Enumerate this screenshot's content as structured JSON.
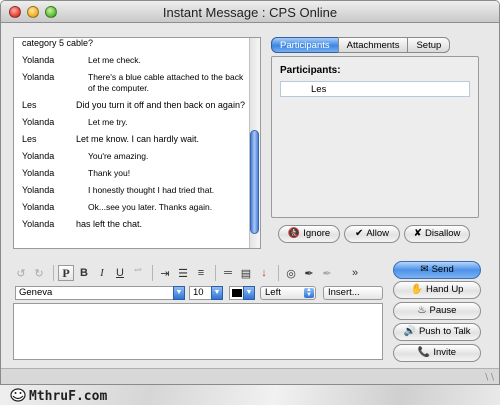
{
  "window": {
    "title": "Instant Message : CPS Online"
  },
  "transcript": {
    "messages": [
      {
        "sender": "",
        "text": "category 5 cable?"
      },
      {
        "sender": "Yolanda",
        "text": "Let me check."
      },
      {
        "sender": "Yolanda",
        "text": "There's a blue cable attached to the back of the computer."
      },
      {
        "sender": "Les",
        "text": "Did you turn it off and then back on again?"
      },
      {
        "sender": "Yolanda",
        "text": "Let me try."
      },
      {
        "sender": "Les",
        "text": "Let me know.  I can hardly wait."
      },
      {
        "sender": "Yolanda",
        "text": "You're amazing."
      },
      {
        "sender": "Yolanda",
        "text": "Thank you!"
      },
      {
        "sender": "Yolanda",
        "text": "I honestly thought I had tried that."
      },
      {
        "sender": "Yolanda",
        "text": "Ok...see you later.  Thanks again."
      },
      {
        "sender": "Yolanda",
        "text": "has left the chat."
      }
    ]
  },
  "tabs": [
    {
      "label": "Participants"
    },
    {
      "label": "Attachments"
    },
    {
      "label": "Setup"
    }
  ],
  "participants": {
    "heading": "Participants:",
    "list": [
      "Les"
    ]
  },
  "participant_actions": {
    "ignore": "Ignore",
    "allow": "Allow",
    "disallow": "Disallow"
  },
  "format": {
    "font": "Geneva",
    "size": "10",
    "align": "Left",
    "insert": "Insert..."
  },
  "actions": {
    "send": "Send",
    "hand_up": "Hand Up",
    "pause": "Pause",
    "push_to_talk": "Push to Talk",
    "invite": "Invite"
  },
  "watermark": {
    "text": "MthruF.com"
  },
  "colors": {
    "accent": "#3d86e1",
    "text_color": "#000000"
  }
}
